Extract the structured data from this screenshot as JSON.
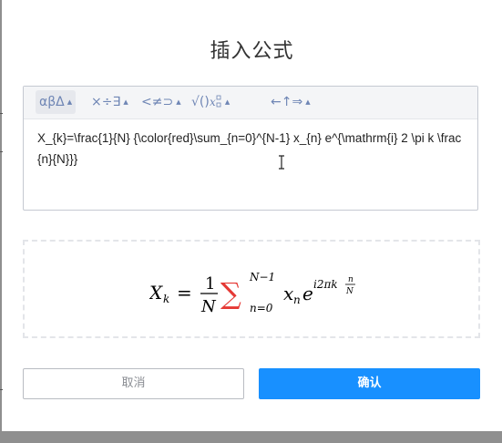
{
  "dialog": {
    "title": "插入公式",
    "cancel_label": "取消",
    "confirm_label": "确认"
  },
  "toolbar": {
    "groups": [
      {
        "label": "αβΔ",
        "icon": "greek-letters-icon"
      },
      {
        "label": "×÷∃",
        "icon": "operators-icon"
      },
      {
        "label": "<≠⊃",
        "icon": "relations-icon"
      },
      {
        "label": "√()",
        "icon": "functions-icon"
      },
      {
        "label": "←↑⇒",
        "icon": "arrows-icon"
      }
    ],
    "caret": "▲"
  },
  "editor": {
    "latex": "X_{k}=\\frac{1}{N} {\\color{red}\\sum_{n=0}^{N-1} x_{n} e^{\\mathrm{i} 2 \\pi k \\frac{n}{N}}}"
  },
  "preview": {
    "X": "X",
    "k": "k",
    "eq": "=",
    "num": "1",
    "den": "N",
    "sum": "∑",
    "upper": "N−1",
    "lower": "n=0",
    "x": "x",
    "n": "n",
    "e": "e",
    "i2pik": "i2πk",
    "frac_num": "n",
    "frac_den": "N"
  },
  "colors": {
    "primary": "#1890ff",
    "sum_color": "#e53935"
  }
}
